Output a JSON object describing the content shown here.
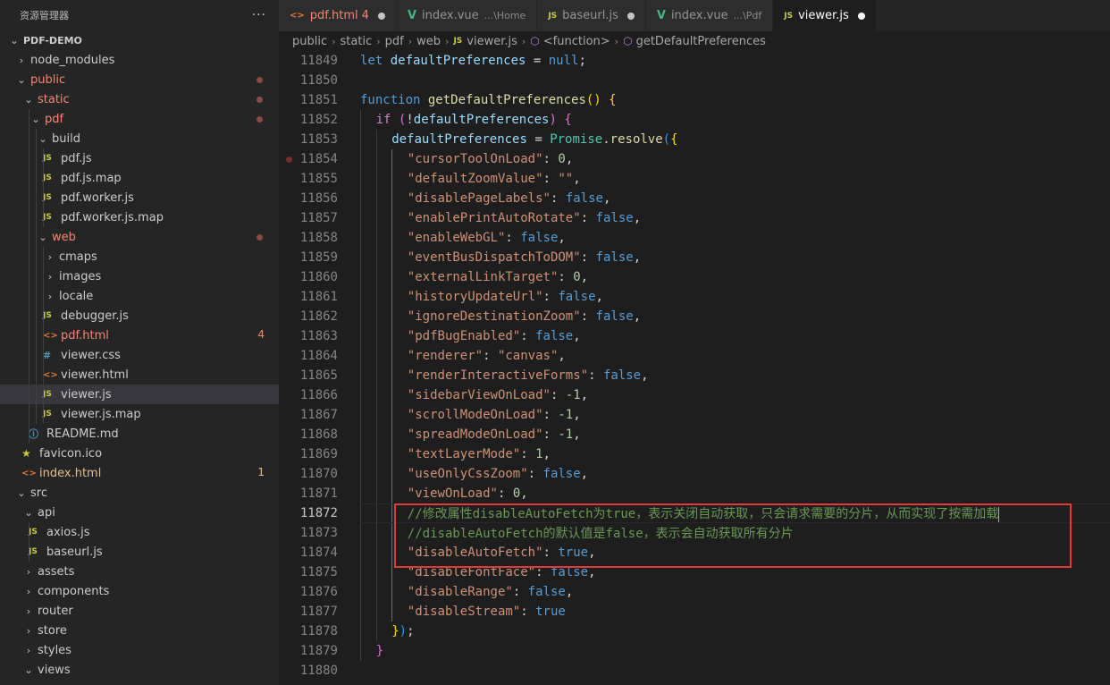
{
  "sidebar": {
    "title": "资源管理器",
    "more": "···",
    "tree": [
      {
        "label": "PDF-DEMO",
        "indent": 0,
        "chev": "⌄",
        "kind": "root"
      },
      {
        "label": "node_modules",
        "indent": 1,
        "chev": "›"
      },
      {
        "label": "public",
        "indent": 1,
        "chev": "⌄",
        "red": true,
        "dot": true
      },
      {
        "label": "static",
        "indent": 2,
        "chev": "⌄",
        "red": true,
        "dot": true
      },
      {
        "label": "pdf",
        "indent": 3,
        "chev": "⌄",
        "red": true,
        "dot": true
      },
      {
        "label": "build",
        "indent": 4,
        "chev": "⌄"
      },
      {
        "label": "pdf.js",
        "indent": 5,
        "icon": "js"
      },
      {
        "label": "pdf.js.map",
        "indent": 5,
        "icon": "js"
      },
      {
        "label": "pdf.worker.js",
        "indent": 5,
        "icon": "js"
      },
      {
        "label": "pdf.worker.js.map",
        "indent": 5,
        "icon": "js"
      },
      {
        "label": "web",
        "indent": 4,
        "chev": "⌄",
        "red": true,
        "dot": true
      },
      {
        "label": "cmaps",
        "indent": 5,
        "chev": "›"
      },
      {
        "label": "images",
        "indent": 5,
        "chev": "›"
      },
      {
        "label": "locale",
        "indent": 5,
        "chev": "›"
      },
      {
        "label": "debugger.js",
        "indent": 5,
        "icon": "js"
      },
      {
        "label": "pdf.html",
        "indent": 5,
        "icon": "html",
        "red": true,
        "num": "4"
      },
      {
        "label": "viewer.css",
        "indent": 5,
        "icon": "css"
      },
      {
        "label": "viewer.html",
        "indent": 5,
        "icon": "html"
      },
      {
        "label": "viewer.js",
        "indent": 5,
        "icon": "js",
        "selected": true
      },
      {
        "label": "viewer.js.map",
        "indent": 5,
        "icon": "js"
      },
      {
        "label": "README.md",
        "indent": 3,
        "icon": "info"
      },
      {
        "label": "favicon.ico",
        "indent": 2,
        "icon": "star"
      },
      {
        "label": "index.html",
        "indent": 2,
        "icon": "html",
        "orange": true,
        "num": "1"
      },
      {
        "label": "src",
        "indent": 1,
        "chev": "⌄"
      },
      {
        "label": "api",
        "indent": 2,
        "chev": "⌄"
      },
      {
        "label": "axios.js",
        "indent": 3,
        "icon": "js"
      },
      {
        "label": "baseurl.js",
        "indent": 3,
        "icon": "js"
      },
      {
        "label": "assets",
        "indent": 2,
        "chev": "›"
      },
      {
        "label": "components",
        "indent": 2,
        "chev": "›"
      },
      {
        "label": "router",
        "indent": 2,
        "chev": "›"
      },
      {
        "label": "store",
        "indent": 2,
        "chev": "›"
      },
      {
        "label": "styles",
        "indent": 2,
        "chev": "›"
      },
      {
        "label": "views",
        "indent": 2,
        "chev": "⌄"
      }
    ]
  },
  "tabs": [
    {
      "label": "pdf.html",
      "icon": "<>",
      "num": "4",
      "red": true,
      "dot": true
    },
    {
      "label": "index.vue",
      "icon": "V",
      "desc": "...\\Home"
    },
    {
      "label": "baseurl.js",
      "icon": "JS",
      "dot": true
    },
    {
      "label": "index.vue",
      "icon": "V",
      "desc": "...\\Pdf"
    },
    {
      "label": "viewer.js",
      "icon": "JS",
      "dot": true,
      "active": true
    }
  ],
  "breadcrumb": {
    "parts": [
      "public",
      "static",
      "pdf",
      "web"
    ],
    "file": "viewer.js",
    "scope": "<function>",
    "symbol": "getDefaultPreferences"
  },
  "editor": {
    "current_line": "11872",
    "lines": [
      {
        "n": "11849",
        "indent": 0,
        "tokens": [
          [
            "kw",
            "let "
          ],
          [
            "var",
            "defaultPreferences"
          ],
          [
            "pl",
            " = "
          ],
          [
            "kw",
            "null"
          ],
          [
            "pl",
            ";"
          ]
        ]
      },
      {
        "n": "11850",
        "indent": 0,
        "tokens": []
      },
      {
        "n": "11851",
        "indent": 0,
        "tokens": [
          [
            "kw",
            "function "
          ],
          [
            "fn",
            "getDefaultPreferences"
          ],
          [
            "br1",
            "()"
          ],
          [
            "pl",
            " "
          ],
          [
            "br1",
            "{"
          ]
        ]
      },
      {
        "n": "11852",
        "indent": 1,
        "tokens": [
          [
            "ctl",
            "if "
          ],
          [
            "br2",
            "("
          ],
          [
            "pl",
            "!"
          ],
          [
            "var",
            "defaultPreferences"
          ],
          [
            "br2",
            ")"
          ],
          [
            "pl",
            " "
          ],
          [
            "br2",
            "{"
          ]
        ]
      },
      {
        "n": "11853",
        "indent": 2,
        "tokens": [
          [
            "var",
            "defaultPreferences"
          ],
          [
            "pl",
            " = "
          ],
          [
            "cls",
            "Promise"
          ],
          [
            "pl",
            "."
          ],
          [
            "fn",
            "resolve"
          ],
          [
            "br3",
            "("
          ],
          [
            "br1",
            "{"
          ]
        ]
      },
      {
        "n": "11854",
        "indent": 3,
        "bp": true,
        "tokens": [
          [
            "str",
            "\"cursorToolOnLoad\""
          ],
          [
            "pl",
            ": "
          ],
          [
            "num",
            "0"
          ],
          [
            "pl",
            ","
          ]
        ]
      },
      {
        "n": "11855",
        "indent": 3,
        "tokens": [
          [
            "str",
            "\"defaultZoomValue\""
          ],
          [
            "pl",
            ": "
          ],
          [
            "str",
            "\"\""
          ],
          [
            "pl",
            ","
          ]
        ]
      },
      {
        "n": "11856",
        "indent": 3,
        "tokens": [
          [
            "str",
            "\"disablePageLabels\""
          ],
          [
            "pl",
            ": "
          ],
          [
            "bool",
            "false"
          ],
          [
            "pl",
            ","
          ]
        ]
      },
      {
        "n": "11857",
        "indent": 3,
        "tokens": [
          [
            "str",
            "\"enablePrintAutoRotate\""
          ],
          [
            "pl",
            ": "
          ],
          [
            "bool",
            "false"
          ],
          [
            "pl",
            ","
          ]
        ]
      },
      {
        "n": "11858",
        "indent": 3,
        "tokens": [
          [
            "str",
            "\"enableWebGL\""
          ],
          [
            "pl",
            ": "
          ],
          [
            "bool",
            "false"
          ],
          [
            "pl",
            ","
          ]
        ]
      },
      {
        "n": "11859",
        "indent": 3,
        "tokens": [
          [
            "str",
            "\"eventBusDispatchToDOM\""
          ],
          [
            "pl",
            ": "
          ],
          [
            "bool",
            "false"
          ],
          [
            "pl",
            ","
          ]
        ]
      },
      {
        "n": "11860",
        "indent": 3,
        "tokens": [
          [
            "str",
            "\"externalLinkTarget\""
          ],
          [
            "pl",
            ": "
          ],
          [
            "num",
            "0"
          ],
          [
            "pl",
            ","
          ]
        ]
      },
      {
        "n": "11861",
        "indent": 3,
        "tokens": [
          [
            "str",
            "\"historyUpdateUrl\""
          ],
          [
            "pl",
            ": "
          ],
          [
            "bool",
            "false"
          ],
          [
            "pl",
            ","
          ]
        ]
      },
      {
        "n": "11862",
        "indent": 3,
        "tokens": [
          [
            "str",
            "\"ignoreDestinationZoom\""
          ],
          [
            "pl",
            ": "
          ],
          [
            "bool",
            "false"
          ],
          [
            "pl",
            ","
          ]
        ]
      },
      {
        "n": "11863",
        "indent": 3,
        "tokens": [
          [
            "str",
            "\"pdfBugEnabled\""
          ],
          [
            "pl",
            ": "
          ],
          [
            "bool",
            "false"
          ],
          [
            "pl",
            ","
          ]
        ]
      },
      {
        "n": "11864",
        "indent": 3,
        "tokens": [
          [
            "str",
            "\"renderer\""
          ],
          [
            "pl",
            ": "
          ],
          [
            "str",
            "\"canvas\""
          ],
          [
            "pl",
            ","
          ]
        ]
      },
      {
        "n": "11865",
        "indent": 3,
        "tokens": [
          [
            "str",
            "\"renderInteractiveForms\""
          ],
          [
            "pl",
            ": "
          ],
          [
            "bool",
            "false"
          ],
          [
            "pl",
            ","
          ]
        ]
      },
      {
        "n": "11866",
        "indent": 3,
        "tokens": [
          [
            "str",
            "\"sidebarViewOnLoad\""
          ],
          [
            "pl",
            ": "
          ],
          [
            "num",
            "-1"
          ],
          [
            "pl",
            ","
          ]
        ]
      },
      {
        "n": "11867",
        "indent": 3,
        "tokens": [
          [
            "str",
            "\"scrollModeOnLoad\""
          ],
          [
            "pl",
            ": "
          ],
          [
            "num",
            "-1"
          ],
          [
            "pl",
            ","
          ]
        ]
      },
      {
        "n": "11868",
        "indent": 3,
        "tokens": [
          [
            "str",
            "\"spreadModeOnLoad\""
          ],
          [
            "pl",
            ": "
          ],
          [
            "num",
            "-1"
          ],
          [
            "pl",
            ","
          ]
        ]
      },
      {
        "n": "11869",
        "indent": 3,
        "tokens": [
          [
            "str",
            "\"textLayerMode\""
          ],
          [
            "pl",
            ": "
          ],
          [
            "num",
            "1"
          ],
          [
            "pl",
            ","
          ]
        ]
      },
      {
        "n": "11870",
        "indent": 3,
        "tokens": [
          [
            "str",
            "\"useOnlyCssZoom\""
          ],
          [
            "pl",
            ": "
          ],
          [
            "bool",
            "false"
          ],
          [
            "pl",
            ","
          ]
        ]
      },
      {
        "n": "11871",
        "indent": 3,
        "tokens": [
          [
            "str",
            "\"viewOnLoad\""
          ],
          [
            "pl",
            ": "
          ],
          [
            "num",
            "0"
          ],
          [
            "pl",
            ","
          ]
        ]
      },
      {
        "n": "11872",
        "indent": 3,
        "tokens": [
          [
            "com",
            "//修改属性disableAutoFetch为true，表示关闭自动获取，只会请求需要的分片，从而实现了按需加载"
          ]
        ],
        "cursor": true
      },
      {
        "n": "11873",
        "indent": 3,
        "tokens": [
          [
            "com",
            "//disableAutoFetch的默认值是false，表示会自动获取所有分片"
          ]
        ]
      },
      {
        "n": "11874",
        "indent": 3,
        "tokens": [
          [
            "str",
            "\"disableAutoFetch\""
          ],
          [
            "pl",
            ": "
          ],
          [
            "bool",
            "true"
          ],
          [
            "pl",
            ","
          ]
        ]
      },
      {
        "n": "11875",
        "indent": 3,
        "tokens": [
          [
            "str",
            "\"disableFontFace\""
          ],
          [
            "pl",
            ": "
          ],
          [
            "bool",
            "false"
          ],
          [
            "pl",
            ","
          ]
        ]
      },
      {
        "n": "11876",
        "indent": 3,
        "tokens": [
          [
            "str",
            "\"disableRange\""
          ],
          [
            "pl",
            ": "
          ],
          [
            "bool",
            "false"
          ],
          [
            "pl",
            ","
          ]
        ]
      },
      {
        "n": "11877",
        "indent": 3,
        "tokens": [
          [
            "str",
            "\"disableStream\""
          ],
          [
            "pl",
            ": "
          ],
          [
            "bool",
            "true"
          ]
        ]
      },
      {
        "n": "11878",
        "indent": 2,
        "tokens": [
          [
            "br1",
            "}"
          ],
          [
            "br3",
            ")"
          ],
          [
            "pl",
            ";"
          ]
        ]
      },
      {
        "n": "11879",
        "indent": 1,
        "tokens": [
          [
            "br2",
            "}"
          ]
        ]
      },
      {
        "n": "11880",
        "indent": 0,
        "tokens": []
      }
    ]
  },
  "colors": {
    "highlight_box": "#e03a3a",
    "sidebar_bg": "#252526",
    "editor_bg": "#1e1e1e"
  }
}
